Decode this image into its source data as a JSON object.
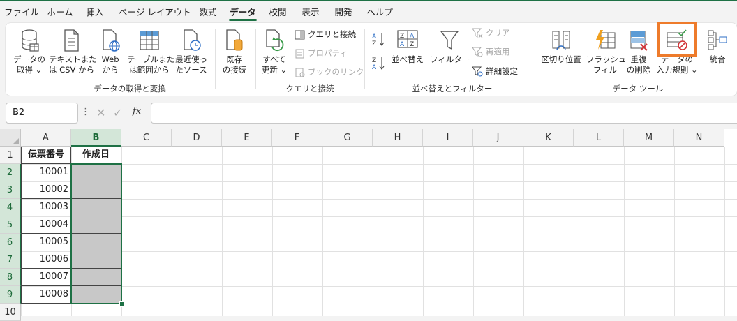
{
  "tabs": [
    {
      "label": "ファイル",
      "active": false
    },
    {
      "label": "ホーム",
      "active": false
    },
    {
      "label": "挿入",
      "active": false
    },
    {
      "label": "ページ レイアウト",
      "active": false
    },
    {
      "label": "数式",
      "active": false
    },
    {
      "label": "データ",
      "active": true
    },
    {
      "label": "校閲",
      "active": false
    },
    {
      "label": "表示",
      "active": false
    },
    {
      "label": "開発",
      "active": false
    },
    {
      "label": "ヘルプ",
      "active": false
    }
  ],
  "ribbon": {
    "get_data": {
      "line1": "データの",
      "line2": "取得 ⌄"
    },
    "from_text": {
      "line1": "テキストまた",
      "line2": "は CSV から"
    },
    "from_web": {
      "line1": "Web",
      "line2": "から"
    },
    "from_table": {
      "line1": "テーブルまた",
      "line2": "は範囲から"
    },
    "recent_sources": {
      "line1": "最近使っ",
      "line2": "たソース"
    },
    "existing_conn": {
      "line1": "既存",
      "line2": "の接続"
    },
    "group1": "データの取得と変換",
    "refresh_all": {
      "line1": "すべて",
      "line2": "更新 ⌄"
    },
    "queries_conn": "クエリと接続",
    "properties": "プロパティ",
    "edit_links": "ブックのリンク",
    "group2": "クエリと接続",
    "sort_az": "A→Z",
    "sort_za": "Z→A",
    "sort": "並べ替え",
    "filter": "フィルター",
    "clear": "クリア",
    "reapply": "再適用",
    "advanced": "詳細設定",
    "group3": "並べ替えとフィルター",
    "text_to_columns": "区切り位置",
    "flash_fill": {
      "line1": "フラッシュ",
      "line2": "フィル"
    },
    "remove_dup": {
      "line1": "重複",
      "line2": "の削除"
    },
    "validation": {
      "line1": "データの",
      "line2": "入力規則 ⌄"
    },
    "consolidate": "統合",
    "group4": "データ ツール"
  },
  "formula_bar": {
    "name_box": "B2",
    "fx": "fx",
    "content": ""
  },
  "columns": [
    "A",
    "B",
    "C",
    "D",
    "E",
    "F",
    "G",
    "H",
    "I",
    "J",
    "K",
    "L",
    "M",
    "N"
  ],
  "rows": [
    "1",
    "2",
    "3",
    "4",
    "5",
    "6",
    "7",
    "8",
    "9",
    "10"
  ],
  "table": {
    "headers": [
      "伝票番号",
      "作成日"
    ],
    "ids": [
      "10001",
      "10002",
      "10003",
      "10004",
      "10005",
      "10006",
      "10007",
      "10008"
    ]
  },
  "colors": {
    "accent": "#1e7145",
    "highlight": "#ee7b2b",
    "selected_fill": "#c8c8c8"
  },
  "selection": "B2"
}
